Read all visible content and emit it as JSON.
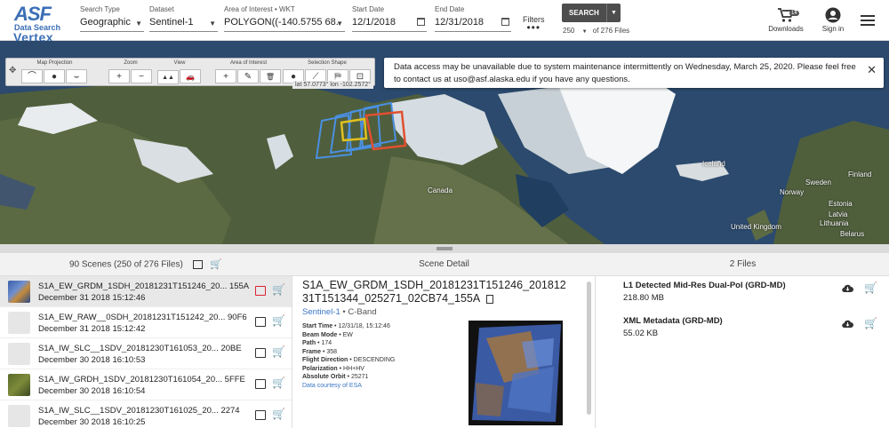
{
  "header": {
    "logo_top": "ASF",
    "logo_mid": "Data Search",
    "logo_bottom": "Vertex",
    "search_type": {
      "label": "Search Type",
      "value": "Geographic"
    },
    "dataset": {
      "label": "Dataset",
      "value": "Sentinel-1"
    },
    "aoi": {
      "label": "Area of Interest • WKT",
      "value": "POLYGON((-140.5755 68."
    },
    "start_date": {
      "label": "Start Date",
      "value": "12/1/2018"
    },
    "end_date": {
      "label": "End Date",
      "value": "12/31/2018"
    },
    "filters_label": "Filters",
    "filters_dots": "•••",
    "search_label": "SEARCH",
    "max_results": "250",
    "of_files": "of 276 Files",
    "downloads_label": "Downloads",
    "downloads_count": "14",
    "signin_label": "Sign in"
  },
  "map_toolbar": {
    "projection": {
      "label": "Map Projection",
      "buttons": [
        "⌒",
        "●",
        "⌣"
      ]
    },
    "zoom": {
      "label": "Zoom",
      "buttons": [
        "+",
        "−"
      ]
    },
    "view": {
      "label": "View",
      "buttons": [
        "▲▲",
        "🚗"
      ]
    },
    "aoi": {
      "label": "Area of Interest",
      "buttons": [
        "+",
        "✎",
        "🗑"
      ]
    },
    "shape": {
      "label": "Selection Shape",
      "buttons": [
        "●",
        "⟋",
        "⛿",
        "⊡"
      ]
    },
    "coords": "lat 57.0773°  lon -102.2572°"
  },
  "banner": {
    "message": "Data access may be unavailable due to system maintenance intermittently on Wednesday, March 25, 2020. Please feel free to contact us at uso@asf.alaska.edu if you have any questions.",
    "close": "✕"
  },
  "map_labels": {
    "canada": "Canada",
    "iceland": "Iceland",
    "uk": "United Kingdom",
    "sweden": "Sweden",
    "norway": "Norway",
    "finland": "Finland",
    "estonia": "Estonia",
    "latvia": "Latvia",
    "lithuania": "Lithuania",
    "belarus": "Belarus"
  },
  "scenes_panel": {
    "header": "90 Scenes (250 of 276 Files)",
    "items": [
      {
        "name": "S1A_EW_GRDM_1SDH_20181231T151246_20... 155A",
        "date": "December 31 2018 15:12:46"
      },
      {
        "name": "S1A_EW_RAW__0SDH_20181231T151242_20... 90F6",
        "date": "December 31 2018 15:12:42"
      },
      {
        "name": "S1A_IW_SLC__1SDV_20181230T161053_20... 20BE",
        "date": "December 30 2018 16:10:53"
      },
      {
        "name": "S1A_IW_GRDH_1SDV_20181230T161054_20... 5FFE",
        "date": "December 30 2018 16:10:54"
      },
      {
        "name": "S1A_IW_SLC__1SDV_20181230T161025_20... 2274",
        "date": "December 30 2018 16:10:25"
      }
    ]
  },
  "scene_detail": {
    "header": "Scene Detail",
    "title": "S1A_EW_GRDM_1SDH_20181231T151246_20181231T151344_025271_02CB74_155A",
    "dataset": "Sentinel-1",
    "band": " • C-Band",
    "props": [
      {
        "label": "Start Time",
        "value": " • 12/31/18, 15:12:46"
      },
      {
        "label": "Beam Mode",
        "value": " • EW"
      },
      {
        "label": "Path",
        "value": " • 174"
      },
      {
        "label": "Frame",
        "value": " • 358"
      },
      {
        "label": "Flight Direction",
        "value": " • DESCENDING"
      },
      {
        "label": "Polarization",
        "value": " • HH+HV"
      },
      {
        "label": "Absolute Orbit",
        "value": " • 25271"
      }
    ],
    "courtesy": "Data courtesy of ESA"
  },
  "files_panel": {
    "header": "2 Files",
    "items": [
      {
        "name": "L1 Detected Mid-Res Dual-Pol (GRD-MD)",
        "size": "218.80 MB"
      },
      {
        "name": "XML Metadata (GRD-MD)",
        "size": "55.02 KB"
      }
    ]
  },
  "colors": {
    "accent": "#3b6fb6",
    "search_button": "#4d4d4d",
    "selected_footprint": "#e0c020",
    "highlight_footprint": "#e05030",
    "footprint": "#4a90e2"
  }
}
